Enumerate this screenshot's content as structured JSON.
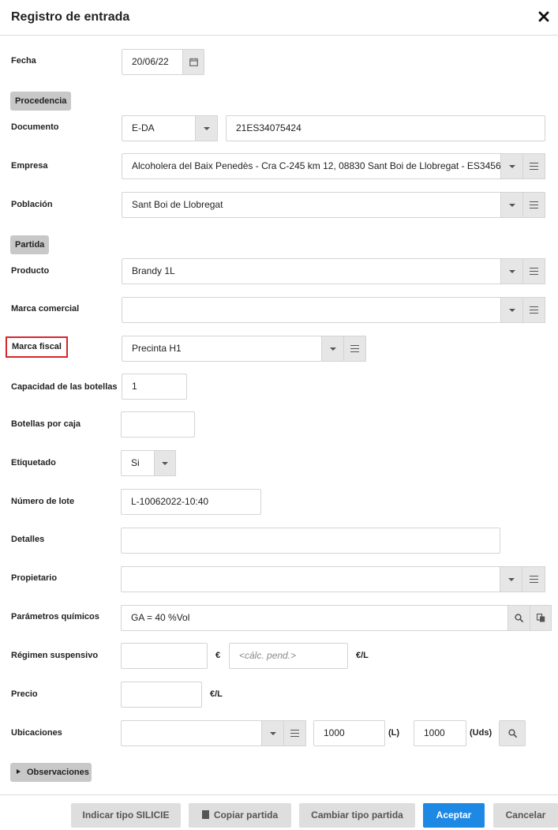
{
  "dialog": {
    "title": "Registro de entrada"
  },
  "fecha": {
    "label": "Fecha",
    "value": "20/06/22"
  },
  "sections": {
    "procedencia": "Procedencia",
    "partida": "Partida"
  },
  "documento": {
    "label": "Documento",
    "type": "E-DA",
    "number": "21ES34075424"
  },
  "empresa": {
    "label": "Empresa",
    "value": "Alcoholera del Baix Penedès - Cra C-245 km 12, 08830 Sant Boi de Llobregat - ES3456"
  },
  "poblacion": {
    "label": "Población",
    "value": "Sant Boi de Llobregat"
  },
  "producto": {
    "label": "Producto",
    "value": "Brandy 1L"
  },
  "marca_comercial": {
    "label": "Marca comercial",
    "value": ""
  },
  "marca_fiscal": {
    "label": "Marca fiscal",
    "value": "Precinta H1"
  },
  "capacidad": {
    "label": "Capacidad de las botellas",
    "value": "1"
  },
  "botellas_caja": {
    "label": "Botellas por caja",
    "value": ""
  },
  "etiquetado": {
    "label": "Etiquetado",
    "value": "Si"
  },
  "lote": {
    "label": "Número de lote",
    "value": "L-10062022-10:40"
  },
  "detalles": {
    "label": "Detalles",
    "value": ""
  },
  "propietario": {
    "label": "Propietario",
    "value": ""
  },
  "parametros": {
    "label": "Parámetros químicos",
    "value": "GA = 40 %Vol"
  },
  "regimen": {
    "label": "Régimen suspensivo",
    "value": "",
    "unit1": "€",
    "placeholder": "<cálc. pend.>",
    "unit2": "€/L"
  },
  "precio": {
    "label": "Precio",
    "value": "",
    "unit": "€/L"
  },
  "ubicaciones": {
    "label": "Ubicaciones",
    "value": "",
    "litros": "1000",
    "litros_unit": "(L)",
    "uds": "1000",
    "uds_unit": "(Uds)"
  },
  "observaciones": {
    "label": "Observaciones"
  },
  "footer": {
    "indicar": "Indicar tipo SILICIE",
    "copiar": "Copiar partida",
    "cambiar": "Cambiar tipo partida",
    "aceptar": "Aceptar",
    "cancelar": "Cancelar"
  },
  "colors": {
    "primary": "#1e88e5",
    "highlight": "#d9242b",
    "section_bg": "#c8c8c8"
  }
}
